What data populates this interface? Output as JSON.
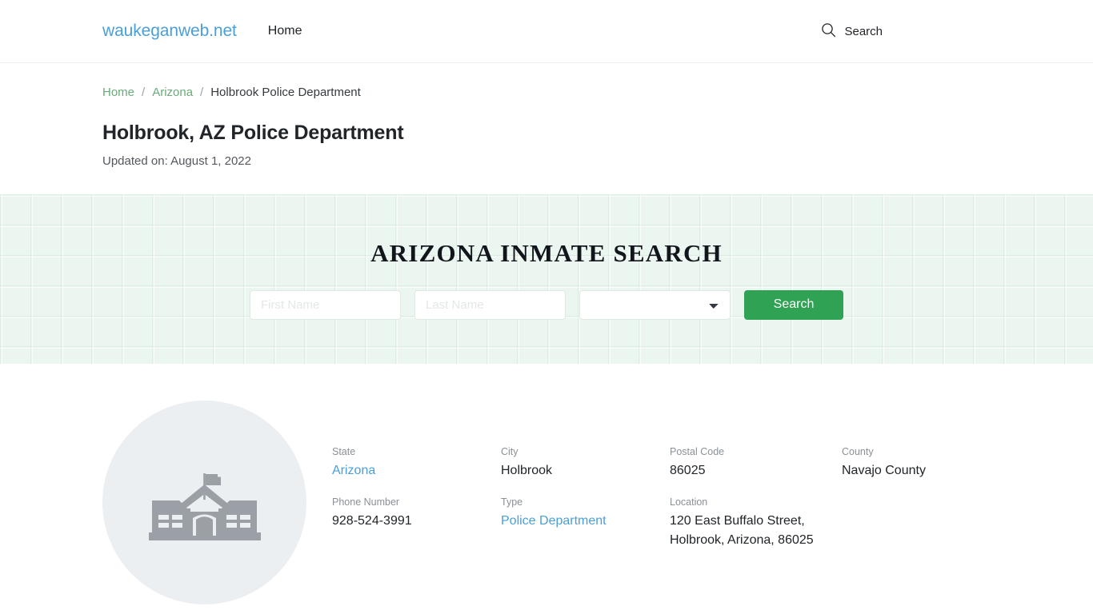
{
  "header": {
    "brand": "waukeganweb.net",
    "nav": [
      {
        "label": "Home"
      }
    ],
    "search_label": "Search",
    "search_icon": "search-icon"
  },
  "breadcrumb": {
    "items": [
      {
        "label": "Home",
        "link": true
      },
      {
        "label": "Arizona",
        "link": true
      },
      {
        "label": "Holbrook Police Department",
        "link": false
      }
    ],
    "separator": "/"
  },
  "page": {
    "title": "Holbrook, AZ Police Department",
    "updated": "Updated on: August 1, 2022"
  },
  "inmate_search": {
    "title": "ARIZONA INMATE SEARCH",
    "first_name_placeholder": "First Name",
    "first_name_value": "",
    "last_name_placeholder": "Last Name",
    "last_name_value": "",
    "county_selected": "",
    "county_options": [
      ""
    ],
    "submit_label": "Search"
  },
  "facility": {
    "icon": "government-building-icon",
    "fields": [
      {
        "label": "State",
        "value": "Arizona",
        "link": true
      },
      {
        "label": "City",
        "value": "Holbrook",
        "link": false
      },
      {
        "label": "Postal Code",
        "value": "86025",
        "link": false
      },
      {
        "label": "County",
        "value": "Navajo County",
        "link": false
      },
      {
        "label": "Phone Number",
        "value": "928-524-3991",
        "link": false
      },
      {
        "label": "Type",
        "value": "Police Department",
        "link": true
      },
      {
        "label": "Location",
        "value": "120 East Buffalo Street, Holbrook, Arizona, 86025",
        "link": false,
        "line1": "120 East Buffalo Street,",
        "line2": "Holbrook, Arizona, 86025"
      }
    ]
  },
  "colors": {
    "brand_blue": "#4a9fd8",
    "breadcrumb_green": "#6aab7a",
    "button_green": "#2fa254",
    "band_background": "#eaf6ef",
    "avatar_background": "#eceff2",
    "link_blue": "#4a9fd8"
  }
}
